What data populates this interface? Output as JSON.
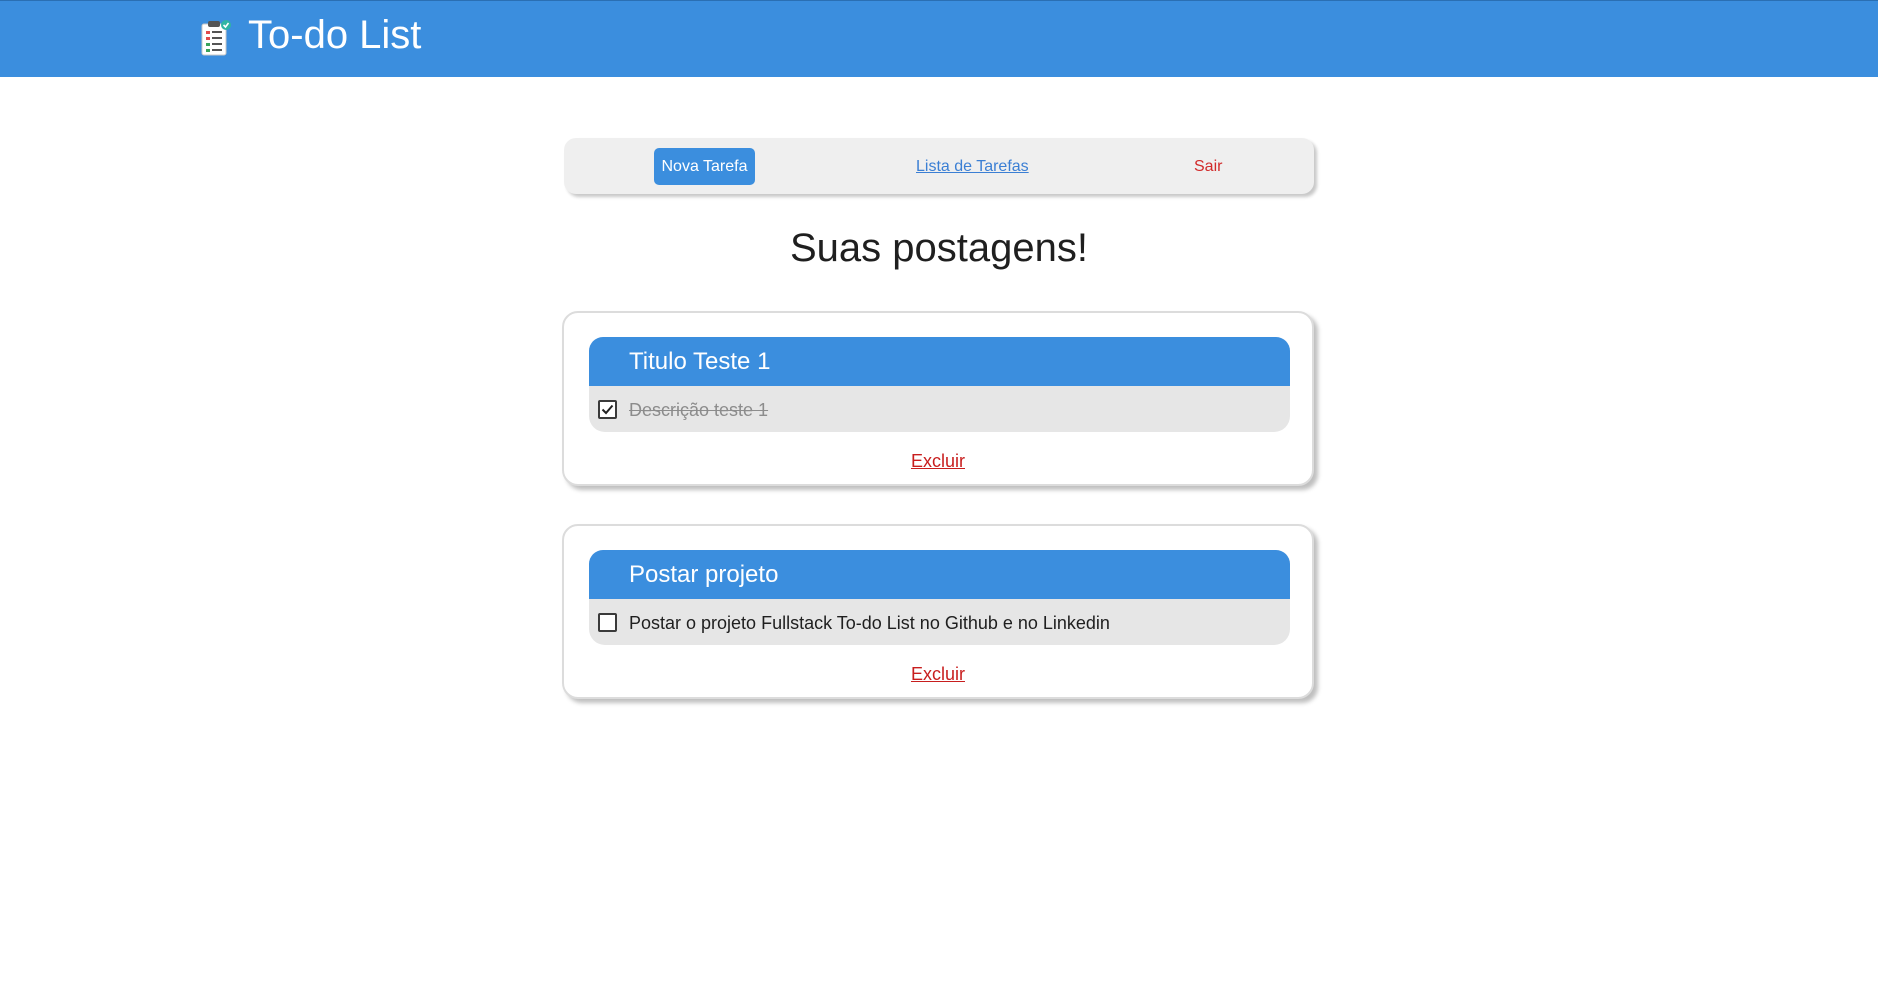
{
  "header": {
    "title": "To-do List",
    "logo_icon": "clipboard-checklist-icon",
    "background_color": "#3b8ede"
  },
  "nav": {
    "new_task_label": "Nova Tarefa",
    "task_list_label": "Lista de Tarefas",
    "exit_label": "Sair"
  },
  "main": {
    "heading": "Suas postagens!"
  },
  "tasks": [
    {
      "title": "Titulo Teste 1",
      "description": "Descrição teste 1",
      "checked": true,
      "delete_label": "Excluir"
    },
    {
      "title": "Postar projeto",
      "description": "Postar o projeto Fullstack To-do List no Github e no Linkedin",
      "checked": false,
      "delete_label": "Excluir"
    }
  ],
  "colors": {
    "accent": "#3b8ede",
    "danger": "#c81e1e",
    "link": "#3b7fd4"
  }
}
